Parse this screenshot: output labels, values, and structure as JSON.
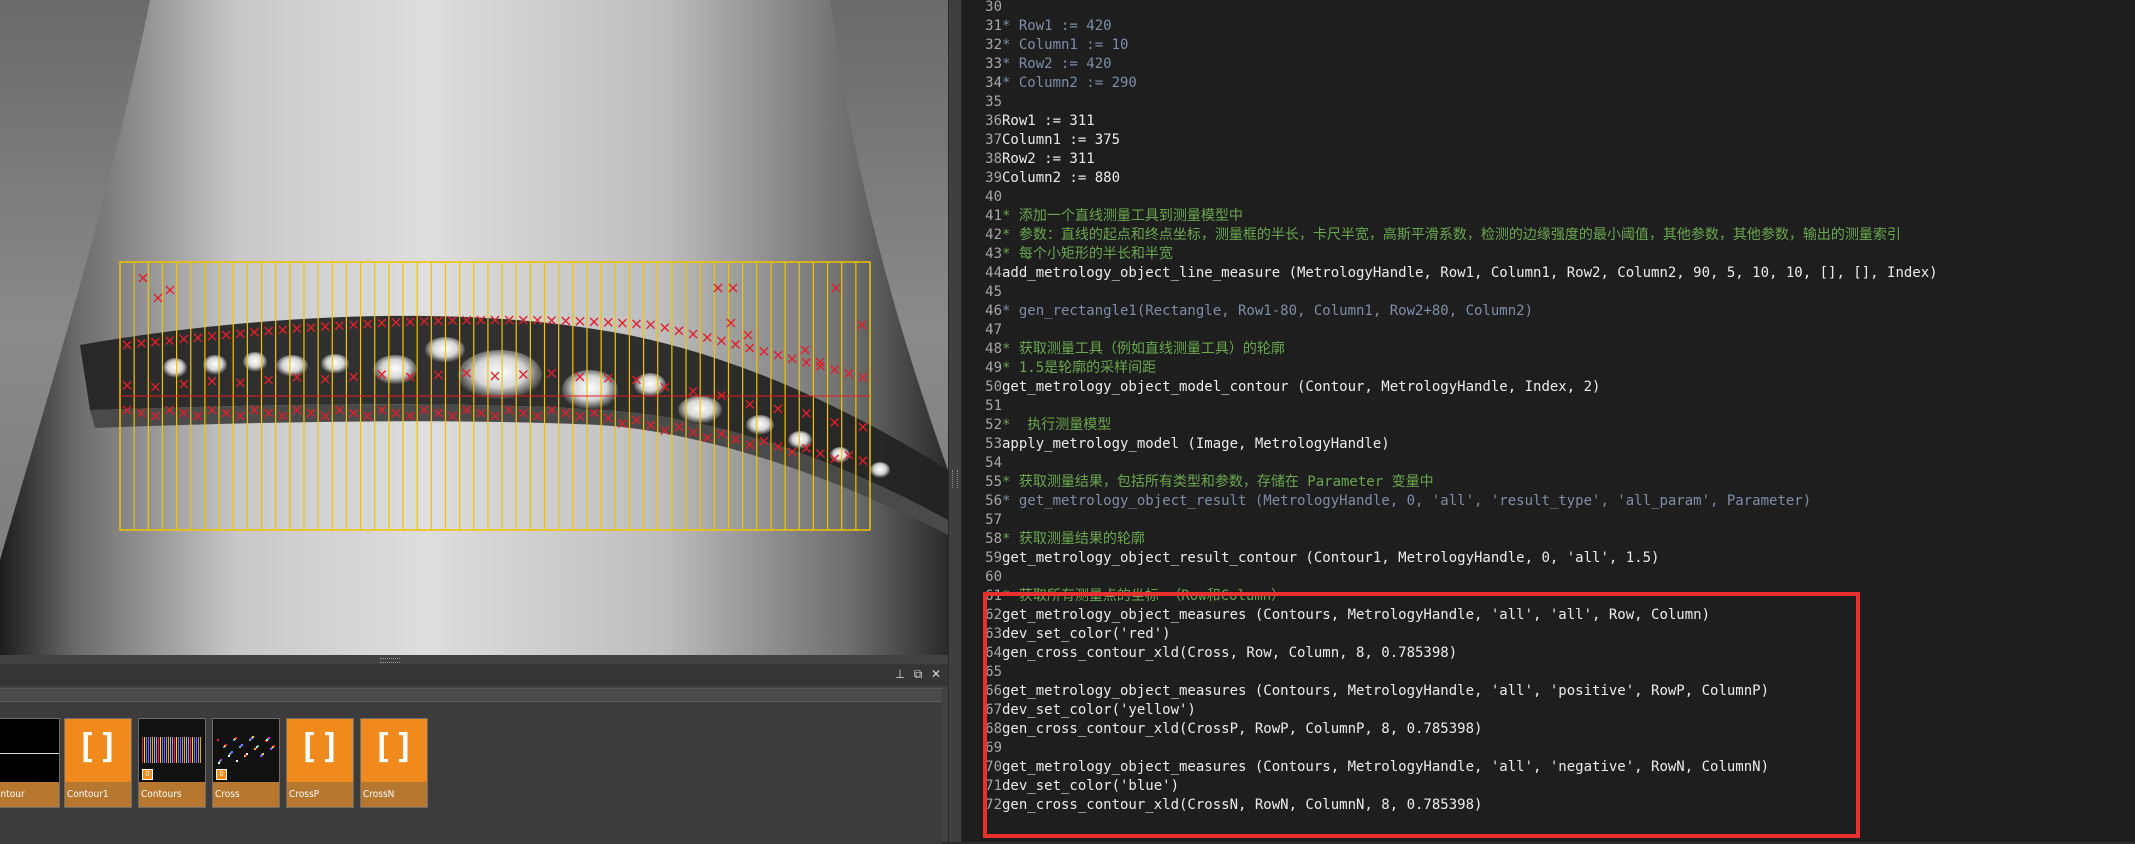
{
  "viewer": {
    "roi_columns": 53,
    "measure_marks": "red-cross"
  },
  "variables": [
    {
      "name": "ontour",
      "kind": "image-line"
    },
    {
      "name": "Contour1",
      "kind": "empty-tuple",
      "thumb": "[]"
    },
    {
      "name": "Contours",
      "kind": "stripes",
      "badge": "0"
    },
    {
      "name": "Cross",
      "kind": "dots",
      "badge": "0"
    },
    {
      "name": "CrossP",
      "kind": "empty-tuple",
      "thumb": "[]"
    },
    {
      "name": "CrossN",
      "kind": "empty-tuple",
      "thumb": "[]"
    }
  ],
  "window_buttons": {
    "pin": "⊥",
    "restore": "⧉",
    "close": "✕"
  },
  "code": {
    "lines": [
      {
        "n": "30",
        "t": "",
        "k": "code"
      },
      {
        "n": "31",
        "t": "* Row1 := 420",
        "k": "cm"
      },
      {
        "n": "32",
        "t": "* Column1 := 10",
        "k": "cm"
      },
      {
        "n": "33",
        "t": "* Row2 := 420",
        "k": "cm"
      },
      {
        "n": "34",
        "t": "* Column2 := 290",
        "k": "cm"
      },
      {
        "n": "35",
        "t": "",
        "k": "code"
      },
      {
        "n": "36",
        "t": "Row1 := 311",
        "k": "code"
      },
      {
        "n": "37",
        "t": "Column1 := 375",
        "k": "code"
      },
      {
        "n": "38",
        "t": "Row2 := 311",
        "k": "code"
      },
      {
        "n": "39",
        "t": "Column2 := 880",
        "k": "code"
      },
      {
        "n": "40",
        "t": "",
        "k": "code"
      },
      {
        "n": "41",
        "t": "* 添加一个直线测量工具到测量模型中",
        "k": "cm-cn"
      },
      {
        "n": "42",
        "t": "* 参数：直线的起点和终点坐标，测量框的半长，卡尺半宽，高斯平滑系数，检测的边缘强度的最小阈值，其他参数，其他参数，输出的测量索引",
        "k": "cm-cn"
      },
      {
        "n": "43",
        "t": "* 每个小矩形的半长和半宽",
        "k": "cm-cn"
      },
      {
        "n": "44",
        "t": "add_metrology_object_line_measure (MetrologyHandle, Row1, Column1, Row2, Column2, 90, 5, 10, 10, [], [], Index)",
        "k": "code"
      },
      {
        "n": "45",
        "t": "",
        "k": "code"
      },
      {
        "n": "46",
        "t": "* gen_rectangle1(Rectangle, Row1-80, Column1, Row2+80, Column2)",
        "k": "cm"
      },
      {
        "n": "47",
        "t": "",
        "k": "code"
      },
      {
        "n": "48",
        "t": "* 获取测量工具（例如直线测量工具）的轮廓",
        "k": "cm-cn"
      },
      {
        "n": "49",
        "t": "* 1.5是轮廓的采样间距",
        "k": "cm-cn"
      },
      {
        "n": "50",
        "t": "get_metrology_object_model_contour (Contour, MetrologyHandle, Index, 2)",
        "k": "code"
      },
      {
        "n": "51",
        "t": "",
        "k": "code"
      },
      {
        "n": "52",
        "t": "*  执行测量模型",
        "k": "cm-cn"
      },
      {
        "n": "53",
        "t": "apply_metrology_model (Image, MetrologyHandle)",
        "k": "code"
      },
      {
        "n": "54",
        "t": "",
        "k": "code"
      },
      {
        "n": "55",
        "t": "* 获取测量结果，包括所有类型和参数，存储在 Parameter 变量中",
        "k": "cm-cn"
      },
      {
        "n": "56",
        "t": "* get_metrology_object_result (MetrologyHandle, 0, 'all', 'result_type', 'all_param', Parameter)",
        "k": "cm"
      },
      {
        "n": "57",
        "t": "",
        "k": "code"
      },
      {
        "n": "58",
        "t": "* 获取测量结果的轮廓",
        "k": "cm-cn"
      },
      {
        "n": "59",
        "t": "get_metrology_object_result_contour (Contour1, MetrologyHandle, 0, 'all', 1.5)",
        "k": "code"
      },
      {
        "n": "60",
        "t": "",
        "k": "code"
      },
      {
        "n": "61",
        "t": "* 获取所有测量点的坐标 （Row和Column）",
        "k": "cm-cn"
      },
      {
        "n": "62",
        "t": "get_metrology_object_measures (Contours, MetrologyHandle, 'all', 'all', Row, Column)",
        "k": "code"
      },
      {
        "n": "63",
        "t": "dev_set_color('red')",
        "k": "code"
      },
      {
        "n": "64",
        "t": "gen_cross_contour_xld(Cross, Row, Column, 8, 0.785398)",
        "k": "code"
      },
      {
        "n": "65",
        "t": "",
        "k": "code"
      },
      {
        "n": "66",
        "t": "get_metrology_object_measures (Contours, MetrologyHandle, 'all', 'positive', RowP, ColumnP)",
        "k": "code"
      },
      {
        "n": "67",
        "t": "dev_set_color('yellow')",
        "k": "code"
      },
      {
        "n": "68",
        "t": "gen_cross_contour_xld(CrossP, RowP, ColumnP, 8, 0.785398)",
        "k": "code"
      },
      {
        "n": "69",
        "t": "",
        "k": "code"
      },
      {
        "n": "70",
        "t": "get_metrology_object_measures (Contours, MetrologyHandle, 'all', 'negative', RowN, ColumnN)",
        "k": "code"
      },
      {
        "n": "71",
        "t": "dev_set_color('blue')",
        "k": "code"
      },
      {
        "n": "72",
        "t": "gen_cross_contour_xld(CrossN, RowN, ColumnN, 8, 0.785398)",
        "k": "code"
      }
    ]
  },
  "colors": {
    "highlight": "#e8312e",
    "roi": "#f2c200",
    "cross": "#e0202a",
    "var_label": "#b8772f"
  }
}
